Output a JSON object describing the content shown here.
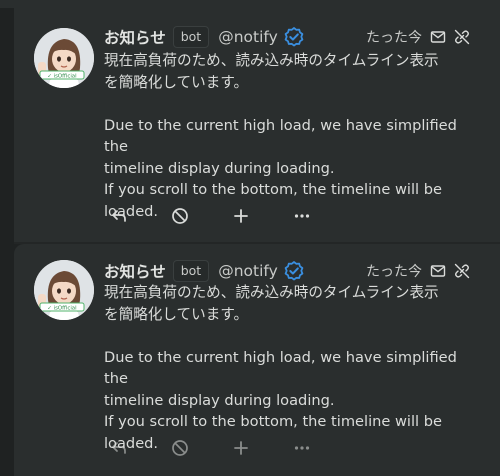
{
  "notes": [
    {
      "name": "お知らせ",
      "badge": "bot",
      "username": "@notify",
      "time": "たった今",
      "text_ja_1": "現在高負荷のため、読み込み時のタイムライン表示",
      "text_ja_2": "を簡略化しています。",
      "text_en_1": "Due to the current high load, we have simplified the",
      "text_en_2": "timeline display during loading.",
      "text_en_3": "If you scroll to the bottom, the timeline will be",
      "text_en_4": "loaded.",
      "avatar_badge": "✓ isOfficial",
      "actions_dimmed": false
    },
    {
      "name": "お知らせ",
      "badge": "bot",
      "username": "@notify",
      "time": "たった今",
      "text_ja_1": "現在高負荷のため、読み込み時のタイムライン表示",
      "text_ja_2": "を簡略化しています。",
      "text_en_1": "Due to the current high load, we have simplified the",
      "text_en_2": "timeline display during loading.",
      "text_en_3": "If you scroll to the bottom, the timeline will be",
      "text_en_4": "loaded.",
      "avatar_badge": "✓ isOfficial",
      "actions_dimmed": true
    }
  ],
  "icons": {
    "verified": "verified-badge-icon",
    "mail": "mail-icon",
    "link_off": "link-off-icon",
    "reply": "reply-icon",
    "block": "no-entry-icon",
    "add": "plus-icon",
    "more": "more-icon"
  },
  "colors": {
    "background": "#1f2222",
    "card": "#2a2e2e",
    "verified": "#3a8fe0",
    "text": "#dadcda"
  }
}
